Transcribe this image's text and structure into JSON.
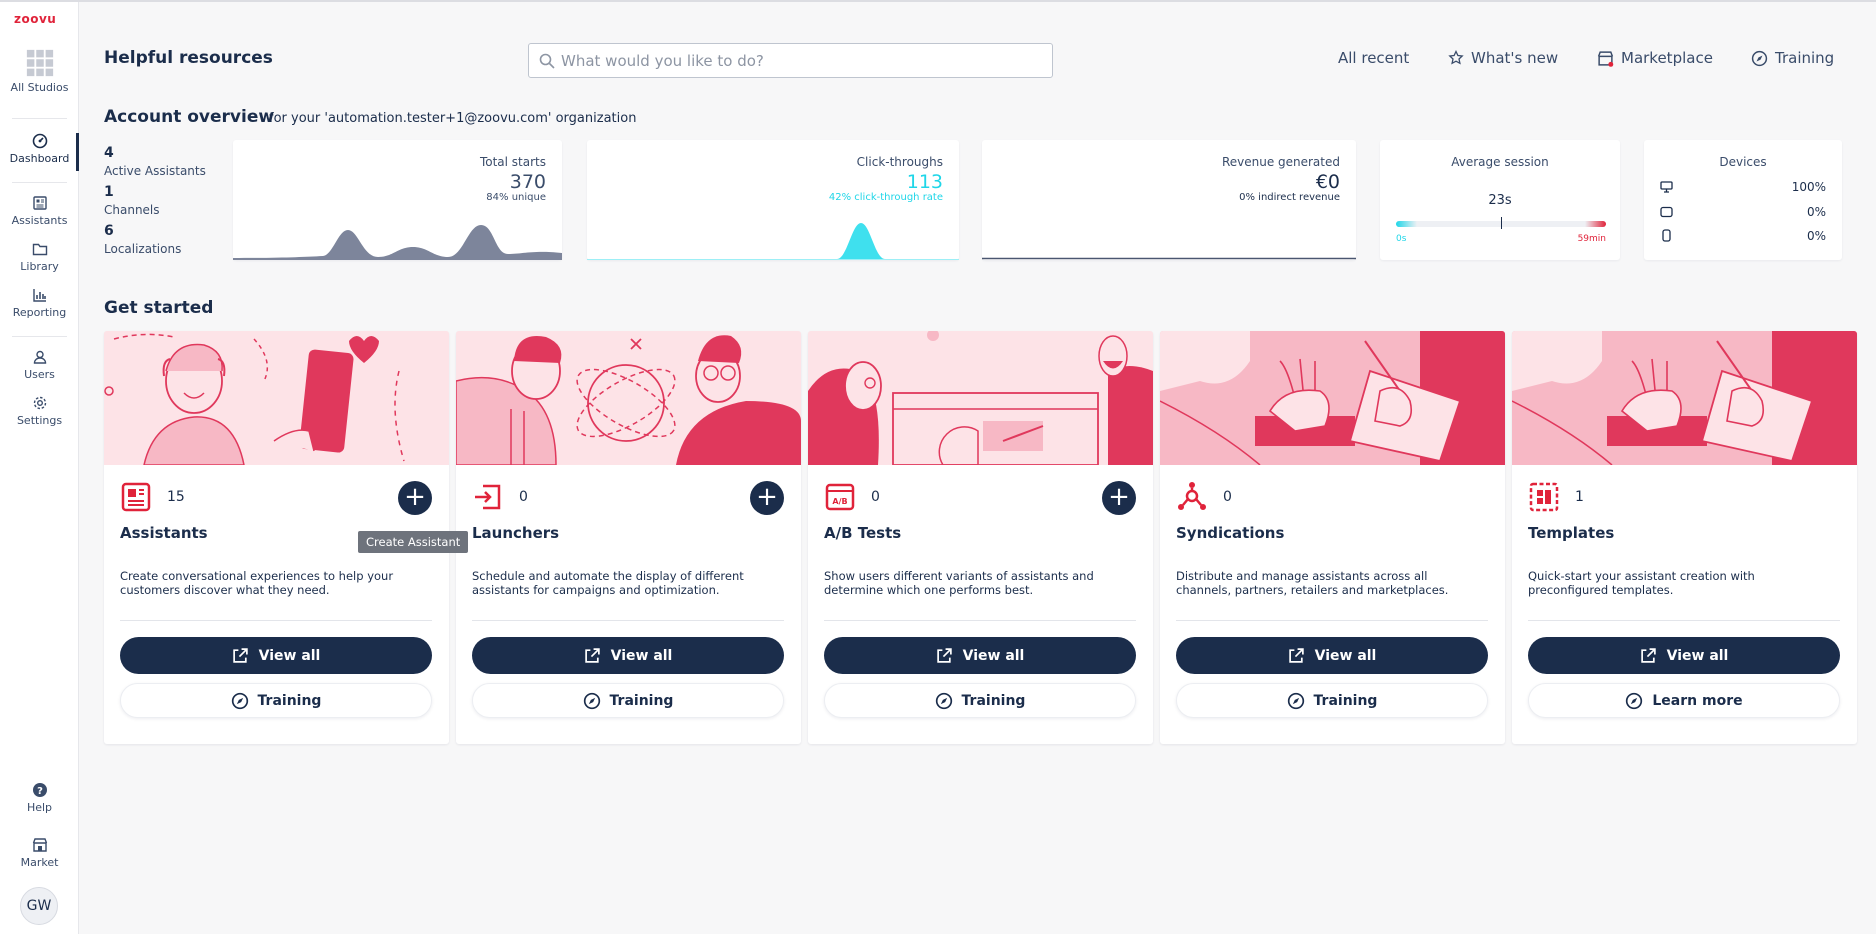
{
  "sidebar": {
    "logo": "zoovu",
    "items": [
      {
        "label": "All Studios",
        "icon": "grid-icon"
      },
      {
        "label": "Dashboard",
        "icon": "dashboard-icon"
      },
      {
        "label": "Assistants",
        "icon": "assistants-icon"
      },
      {
        "label": "Library",
        "icon": "folder-icon"
      },
      {
        "label": "Reporting",
        "icon": "bar-chart-icon"
      },
      {
        "label": "Users",
        "icon": "user-icon"
      },
      {
        "label": "Settings",
        "icon": "gear-icon"
      },
      {
        "label": "Help",
        "icon": "help-icon"
      },
      {
        "label": "Market",
        "icon": "store-icon"
      }
    ],
    "avatar": "GW"
  },
  "header": {
    "title": "Helpful resources",
    "search_placeholder": "What would you like to do?",
    "links": [
      "All recent",
      "What's new",
      "Marketplace",
      "Training"
    ]
  },
  "overview": {
    "title": "Account overview",
    "subtitle": "for your 'automation.tester+1@zoovu.com' organization",
    "stats": [
      {
        "value": "4",
        "label": "Active Assistants"
      },
      {
        "value": "1",
        "label": "Channels"
      },
      {
        "value": "6",
        "label": "Localizations"
      }
    ],
    "total_starts": {
      "title": "Total starts",
      "value": "370",
      "sub": "84% unique"
    },
    "click_throughs": {
      "title": "Click-throughs",
      "value": "113",
      "sub": "42% click-through rate"
    },
    "revenue": {
      "title": "Revenue generated",
      "value": "€0",
      "sub": "0% indirect revenue"
    },
    "session": {
      "title": "Average session",
      "value": "23s",
      "min": "0s",
      "max": "59min",
      "position": 0.5
    },
    "devices": {
      "title": "Devices",
      "rows": [
        {
          "icon": "desktop-icon",
          "value": "100%"
        },
        {
          "icon": "tablet-icon",
          "value": "0%"
        },
        {
          "icon": "mobile-icon",
          "value": "0%"
        }
      ]
    }
  },
  "get_started": {
    "title": "Get started",
    "tooltip": "Create Assistant",
    "cards": [
      {
        "name": "Assistants",
        "count": "15",
        "desc": "Create conversational experiences to help your customers discover what they need.",
        "primary": "View all",
        "secondary": "Training",
        "has_plus": true
      },
      {
        "name": "Launchers",
        "count": "0",
        "desc": "Schedule and automate the display of different assistants for campaigns and optimization.",
        "primary": "View all",
        "secondary": "Training",
        "has_plus": true
      },
      {
        "name": "A/B Tests",
        "count": "0",
        "desc": "Show users different variants of assistants and determine which one performs best.",
        "primary": "View all",
        "secondary": "Training",
        "has_plus": true
      },
      {
        "name": "Syndications",
        "count": "0",
        "desc": "Distribute and manage assistants across all channels, partners, retailers and marketplaces.",
        "primary": "View all",
        "secondary": "Training",
        "has_plus": false
      },
      {
        "name": "Templates",
        "count": "1",
        "desc": "Quick-start your assistant creation with preconfigured templates.",
        "primary": "View all",
        "secondary": "Learn more",
        "has_plus": false
      }
    ]
  },
  "colors": {
    "brand": "#e0233a",
    "navy": "#1b2d4b",
    "cyan": "#1fd6e8",
    "pink_bg": "#fde3e7",
    "pink_dark": "#e0385c"
  }
}
